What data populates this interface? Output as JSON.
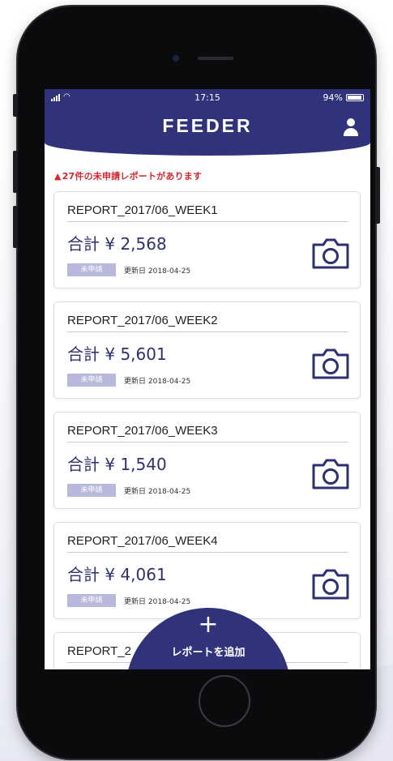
{
  "status_bar": {
    "time": "17:15",
    "battery": "94%",
    "battery_level": 0.94
  },
  "header": {
    "title": "FEEDER"
  },
  "alert": {
    "icon": "warning-triangle-icon",
    "text": "27件の未申請レポートがあります"
  },
  "reports": [
    {
      "title": "REPORT_2017/06_WEEK1",
      "total": "合計 ¥ 2,568",
      "status": "未申請",
      "updated": "更新日 2018-04-25"
    },
    {
      "title": "REPORT_2017/06_WEEK2",
      "total": "合計 ¥ 5,601",
      "status": "未申請",
      "updated": "更新日 2018-04-25"
    },
    {
      "title": "REPORT_2017/06_WEEK3",
      "total": "合計 ¥ 1,540",
      "status": "未申請",
      "updated": "更新日 2018-04-25"
    },
    {
      "title": "REPORT_2017/06_WEEK4",
      "total": "合計 ¥ 4,061",
      "status": "未申請",
      "updated": "更新日 2018-04-25"
    },
    {
      "title": "REPORT_2"
    }
  ],
  "fab": {
    "plus": "+",
    "label": "レポートを追加"
  },
  "colors": {
    "brand": "#30327a",
    "alert": "#d3282f",
    "pill": "#b7b8dc"
  }
}
